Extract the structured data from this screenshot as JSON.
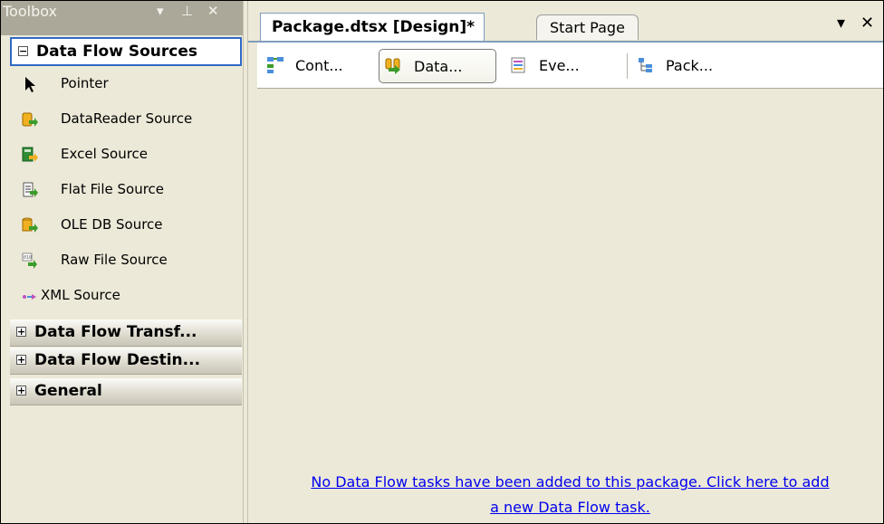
{
  "toolbox": {
    "title": "Toolbox",
    "pin_glyph": "▾ ᵖ",
    "close_glyph": "✕",
    "categories": [
      {
        "label": "Data Flow Sources",
        "expanded": true,
        "toggle": "−",
        "items": [
          {
            "label": "Pointer",
            "icon": "pointer-icon"
          },
          {
            "label": "DataReader Source",
            "icon": "datareader-source-icon"
          },
          {
            "label": "Excel Source",
            "icon": "excel-source-icon"
          },
          {
            "label": "Flat File Source",
            "icon": "flat-file-source-icon"
          },
          {
            "label": "OLE DB Source",
            "icon": "ole-db-source-icon"
          },
          {
            "label": "Raw File Source",
            "icon": "raw-file-source-icon"
          },
          {
            "label": "XML Source",
            "icon": "xml-source-icon"
          }
        ]
      },
      {
        "label": "Data Flow Transf...",
        "expanded": false,
        "toggle": "+"
      },
      {
        "label": "Data Flow Destin...",
        "expanded": false,
        "toggle": "+"
      },
      {
        "label": "General",
        "expanded": false,
        "toggle": "+"
      }
    ]
  },
  "document_tabs": {
    "active": "Package.dtsx [Design]*",
    "inactive": "Start Page",
    "dropdown_glyph": "▾",
    "close_glyph": "✕"
  },
  "designer_tabs": [
    {
      "label": "Cont...",
      "icon": "control-flow-icon",
      "active": false
    },
    {
      "label": "Data...",
      "icon": "data-flow-icon",
      "active": true
    },
    {
      "label": "Eve...",
      "icon": "event-handlers-icon",
      "active": false
    },
    {
      "label": "Pack...",
      "icon": "package-explorer-icon",
      "active": false
    }
  ],
  "canvas": {
    "link_line1": "No Data Flow tasks have been added to this package. Click here to add",
    "link_line2": "a new Data Flow task."
  },
  "colors": {
    "accent_border": "#316ac5",
    "link": "#0000ee",
    "panel_bg": "#ece9d8"
  }
}
